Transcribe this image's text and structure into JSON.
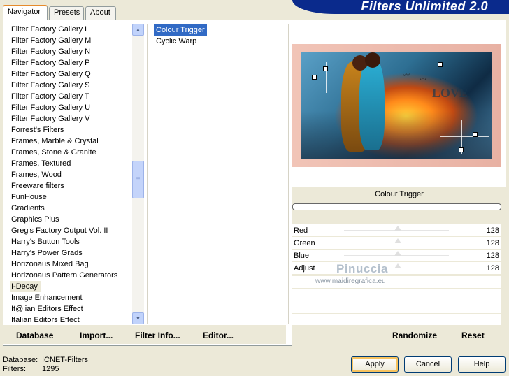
{
  "app": {
    "title": "Filters Unlimited 2.0"
  },
  "tabs": [
    {
      "label": "Navigator",
      "active": true
    },
    {
      "label": "Presets",
      "active": false
    },
    {
      "label": "About",
      "active": false
    }
  ],
  "categories": [
    "Filter Factory Gallery L",
    "Filter Factory Gallery M",
    "Filter Factory Gallery N",
    "Filter Factory Gallery P",
    "Filter Factory Gallery Q",
    "Filter Factory Gallery S",
    "Filter Factory Gallery T",
    "Filter Factory Gallery U",
    "Filter Factory Gallery V",
    "Forrest's Filters",
    "Frames, Marble & Crystal",
    "Frames, Stone & Granite",
    "Frames, Textured",
    "Frames, Wood",
    "Freeware filters",
    "FunHouse",
    "Gradients",
    "Graphics Plus",
    "Greg's Factory Output Vol. II",
    "Harry's Button Tools",
    "Harry's Power Grads",
    "Horizonaus Mixed Bag",
    "Horizonaus Pattern Generators",
    "I-Decay",
    "Image Enhancement",
    "It@lian Editors Effect",
    "Italian Editors Effect"
  ],
  "selected_category": "I-Decay",
  "filters": [
    "Colour Trigger",
    "Cyclic Warp"
  ],
  "selected_filter": "Colour Trigger",
  "preview": {
    "art_text": "LOVE"
  },
  "filter_name": "Colour Trigger",
  "params": [
    {
      "label": "Red",
      "value": "128"
    },
    {
      "label": "Green",
      "value": "128"
    },
    {
      "label": "Blue",
      "value": "128"
    },
    {
      "label": "Adjust",
      "value": "128"
    }
  ],
  "watermark": {
    "name": "Pinuccia",
    "url": "www.maidiregrafica.eu"
  },
  "left_buttons": {
    "database": "Database",
    "import": "Import...",
    "filter_info": "Filter Info...",
    "editor": "Editor..."
  },
  "right_buttons": {
    "randomize": "Randomize",
    "reset": "Reset"
  },
  "status": {
    "database_label": "Database:",
    "database_value": "ICNET-Filters",
    "filters_label": "Filters:",
    "filters_value": "1295"
  },
  "dialog": {
    "apply": "Apply",
    "cancel": "Cancel",
    "help": "Help"
  },
  "colors": {
    "banner": "#0a2a8c",
    "selection": "#316ac5",
    "accent_tab": "#e68b2c"
  }
}
